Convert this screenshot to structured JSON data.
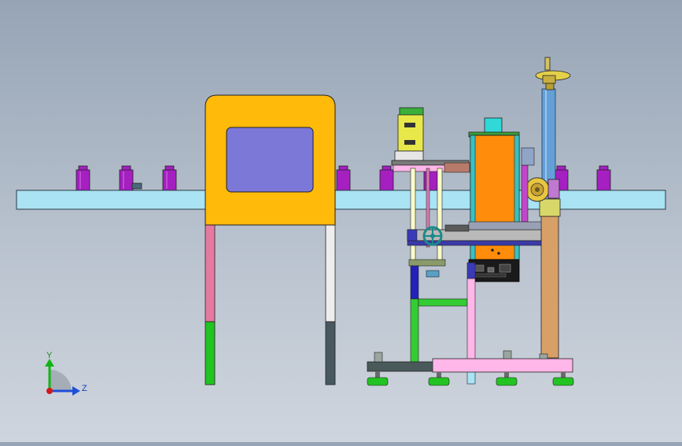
{
  "triad": {
    "y_label": "Y",
    "z_label": "Z"
  },
  "colors": {
    "conveyor": "#a9e3f4",
    "guard_frame": "#ffba0a",
    "guard_window": "#7b78d8",
    "bottle": "#a51fc1",
    "labeler_body": "#ff8c0a",
    "column": "#64a0d8",
    "base_plate": "#ffb6e8",
    "axis_y": "#12b312",
    "axis_z": "#1e4fd8",
    "axis_origin": "#d41818"
  }
}
